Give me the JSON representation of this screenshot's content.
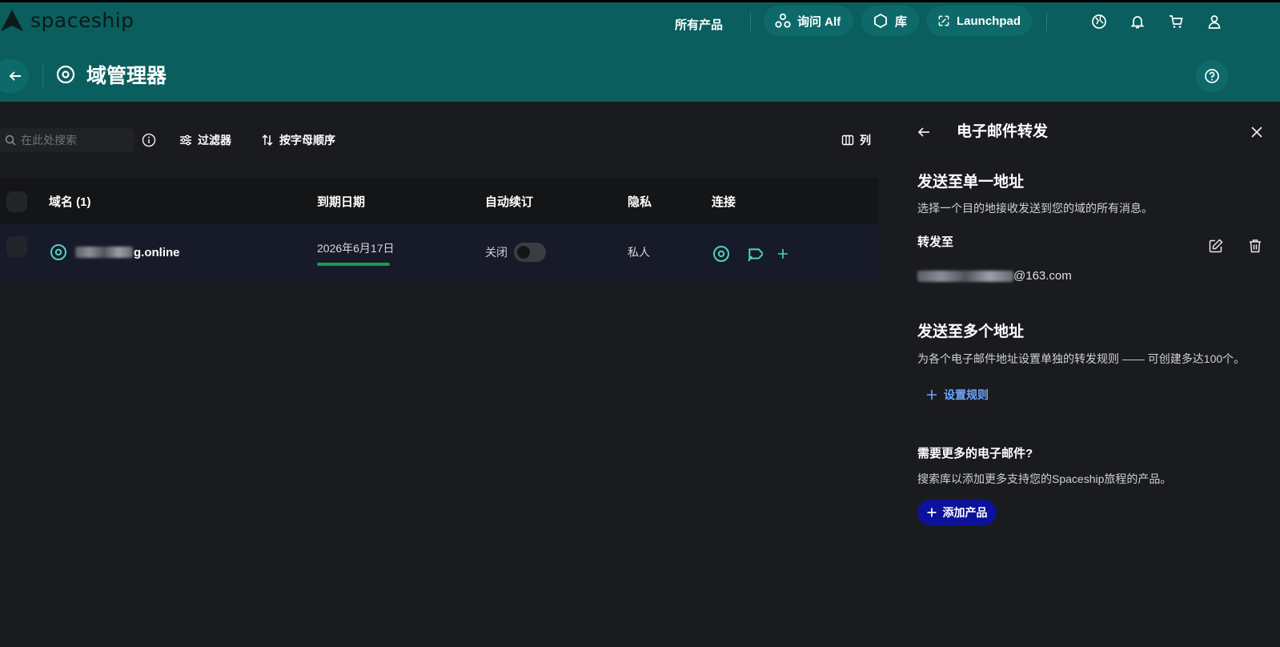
{
  "brand": {
    "name": "spaceship"
  },
  "header": {
    "all_products": "所有产品",
    "ask_alf": "询问 Alf",
    "library": "库",
    "launchpad": "Launchpad",
    "page_title": "域管理器"
  },
  "toolbar": {
    "search_placeholder": "在此处搜索",
    "filter_label": "过滤器",
    "sort_label": "按字母顺序",
    "columns_label": "列"
  },
  "table": {
    "columns": {
      "domain": "域名 (1)",
      "expiry": "到期日期",
      "auto_renew": "自动续订",
      "privacy": "隐私",
      "connect": "连接"
    },
    "rows": [
      {
        "domain_visible": "g.online",
        "expiry": "2026年6月17日",
        "auto_renew_label": "关闭",
        "auto_renew_on": false,
        "privacy": "私人"
      }
    ]
  },
  "panel": {
    "title": "电子邮件转发",
    "single": {
      "heading": "发送至单一地址",
      "description": "选择一个目的地接收发送到您的域的所有消息。",
      "forward_label": "转发至",
      "email_visible": "@163.com"
    },
    "multiple": {
      "heading": "发送至多个地址",
      "description": "为各个电子邮件地址设置单独的转发规则 —— 可创建多达100个。",
      "setup_rule": "设置规则"
    },
    "more": {
      "heading": "需要更多的电子邮件?",
      "description": "搜索库以添加更多支持您的Spaceship旅程的产品。",
      "add_product": "添加产品"
    }
  },
  "colors": {
    "header_bg": "#0b5e5e",
    "accent_teal": "#4fd1c5",
    "link_blue": "#6ea8ff",
    "primary_button": "#0c129b",
    "expiry_bar": "#1a9a56"
  }
}
